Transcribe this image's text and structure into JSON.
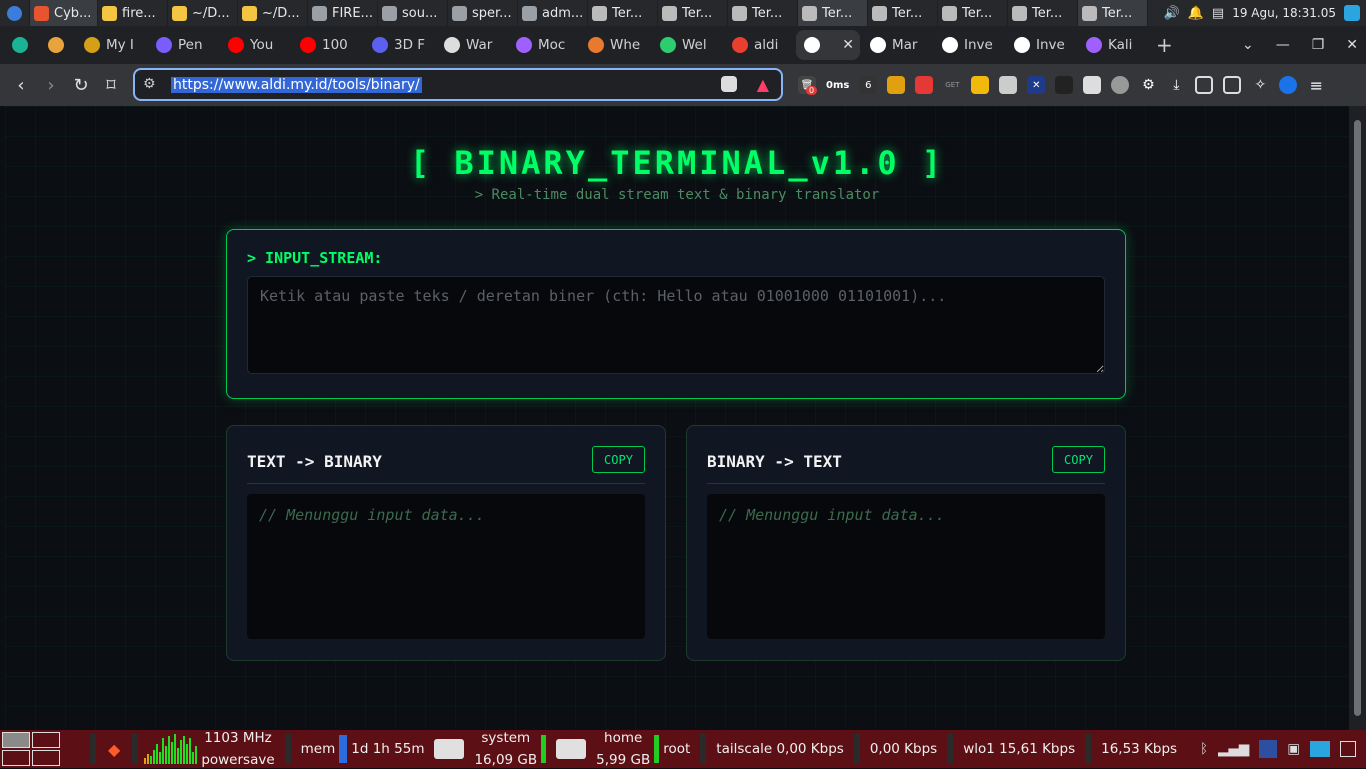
{
  "os_top": {
    "tasks": [
      {
        "label": "Cyb...",
        "color": "#e8542f",
        "active": true
      },
      {
        "label": "fire...",
        "color": "#f4c542"
      },
      {
        "label": "~/D...",
        "color": "#f4c542"
      },
      {
        "label": "~/D...",
        "color": "#f4c542"
      },
      {
        "label": "FIRE...",
        "color": "#9aa0a6"
      },
      {
        "label": "sou...",
        "color": "#9aa0a6"
      },
      {
        "label": "sper...",
        "color": "#9aa0a6"
      },
      {
        "label": "adm...",
        "color": "#9aa0a6"
      },
      {
        "label": "Ter...",
        "color": "#bbbbbb"
      },
      {
        "label": "Ter...",
        "color": "#bbbbbb"
      },
      {
        "label": "Ter...",
        "color": "#bbbbbb"
      },
      {
        "label": "Ter...",
        "color": "#bbbbbb",
        "active": true
      },
      {
        "label": "Ter...",
        "color": "#bbbbbb"
      },
      {
        "label": "Ter...",
        "color": "#bbbbbb"
      },
      {
        "label": "Ter...",
        "color": "#bbbbbb"
      },
      {
        "label": "Ter...",
        "color": "#bbbbbb",
        "active": true
      }
    ],
    "clock": "19 Agu, 18:31.05"
  },
  "tabs": [
    {
      "label": "",
      "color": "#1ab394"
    },
    {
      "label": "",
      "color": "#e8a33d"
    },
    {
      "label": "My I",
      "color": "#d4a017"
    },
    {
      "label": "Pen",
      "color": "#7b5cff"
    },
    {
      "label": "You",
      "color": "#ff0000"
    },
    {
      "label": "100",
      "color": "#ff0000"
    },
    {
      "label": "3D F",
      "color": "#5d5fef"
    },
    {
      "label": "War",
      "color": "#dddddd"
    },
    {
      "label": "Moc",
      "color": "#a060ff"
    },
    {
      "label": "Whe",
      "color": "#e87a2f"
    },
    {
      "label": "Wel",
      "color": "#2ecc71"
    },
    {
      "label": "aldi",
      "color": "#e83f2f"
    },
    {
      "label": "",
      "color": "#ffffff",
      "active": true
    },
    {
      "label": "Mar",
      "color": "#ffffff"
    },
    {
      "label": "Inve",
      "color": "#ffffff"
    },
    {
      "label": "Inve",
      "color": "#ffffff"
    },
    {
      "label": "Kali",
      "color": "#a060ff"
    }
  ],
  "address": {
    "url": "https://www.aldi.my.id/tools/binary/",
    "timer_badge": "0ms",
    "count_badge": "0"
  },
  "page": {
    "title": "[ BINARY_TERMINAL_v1.0 ]",
    "subtitle": "> Real-time dual stream text & binary translator",
    "input_label": "> INPUT_STREAM:",
    "input_placeholder": "Ketik atau paste teks / deretan biner (cth: Hello atau 01001000 01101001)...",
    "panels": [
      {
        "title": "TEXT -> BINARY",
        "copy": "COPY",
        "output": "// Menunggu input data..."
      },
      {
        "title": "BINARY -> TEXT",
        "copy": "COPY",
        "output": "// Menunggu input data..."
      }
    ]
  },
  "os_bottom": {
    "cpu_freq": "1103 MHz",
    "cpu_governor": "powersave",
    "mem_label": "mem",
    "uptime": "1d 1h 55m",
    "disk1_name": "system",
    "disk1_size": "16,09 GB",
    "disk2_name": "home",
    "disk2_size": "5,99 GB",
    "root_label": "root",
    "tailscale": "tailscale 0,00 Kbps",
    "tailscale_down": "0,00 Kbps",
    "wlo1": "wlo1  15,61 Kbps",
    "wlo1_down": "16,53 Kbps"
  }
}
